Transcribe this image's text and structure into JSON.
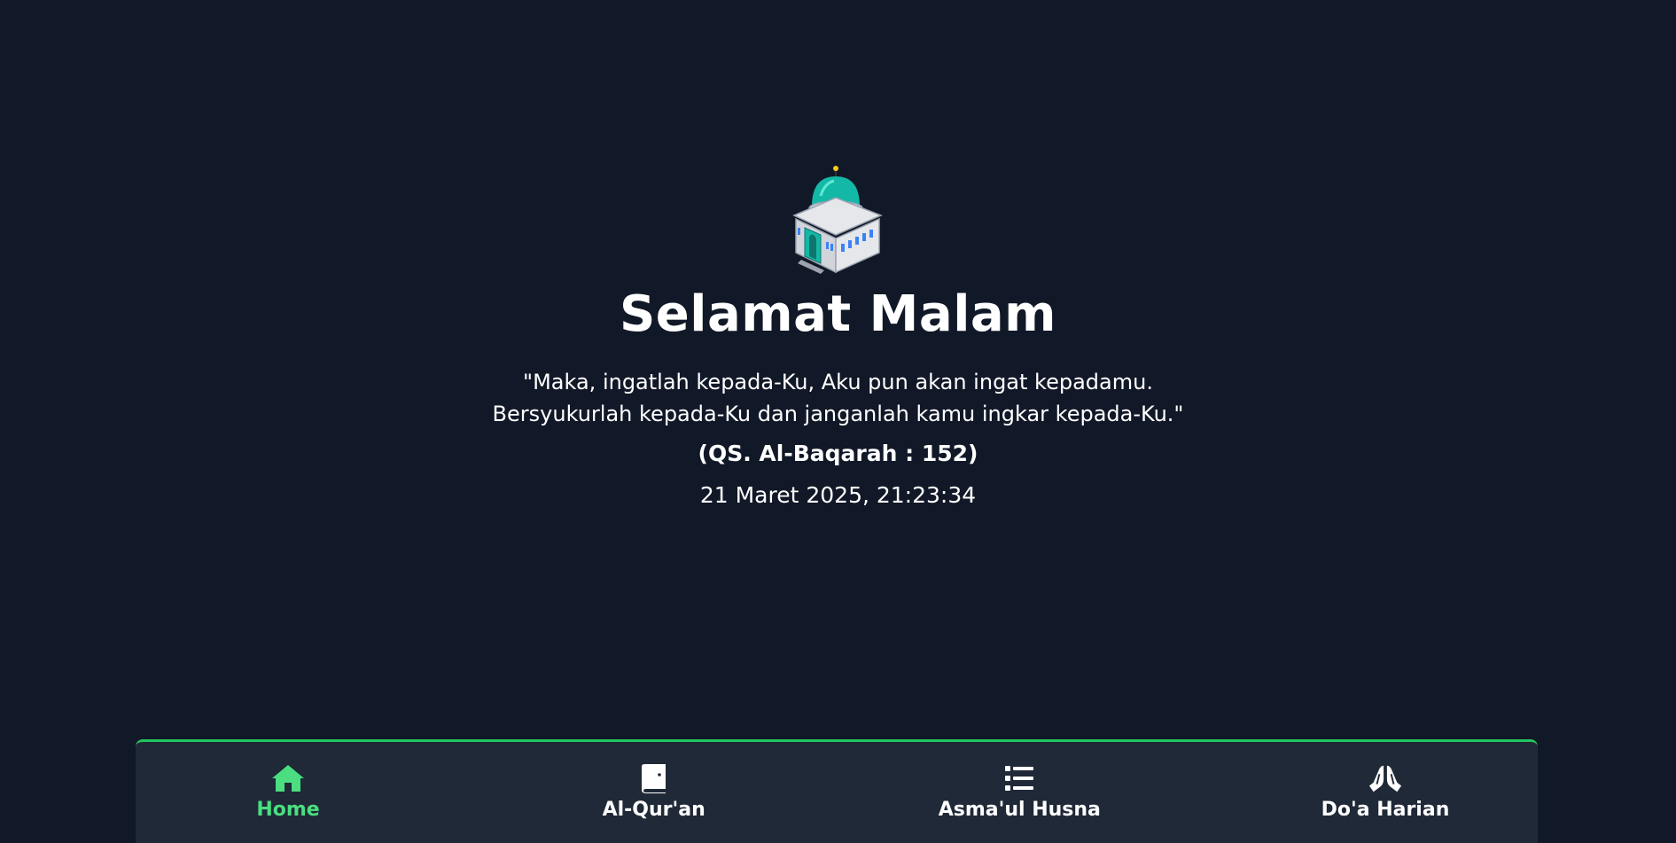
{
  "greeting": "Selamat Malam",
  "quote": {
    "line1": "\"Maka, ingatlah kepada-Ku, Aku pun akan ingat kepadamu.",
    "line2": "Bersyukurlah kepada-Ku dan janganlah kamu ingkar kepada-Ku.\""
  },
  "source": "(QS. Al-Baqarah : 152)",
  "datetime": "21 Maret 2025, 21:23:34",
  "nav": {
    "active_color": "#4ade80",
    "accent_color": "#22c55e",
    "items": [
      {
        "label": "Home",
        "icon": "home-icon",
        "active": true
      },
      {
        "label": "Al-Qur'an",
        "icon": "quran-book-icon",
        "active": false
      },
      {
        "label": "Asma'ul Husna",
        "icon": "list-icon",
        "active": false
      },
      {
        "label": "Do'a Harian",
        "icon": "praying-hands-icon",
        "active": false
      }
    ]
  }
}
